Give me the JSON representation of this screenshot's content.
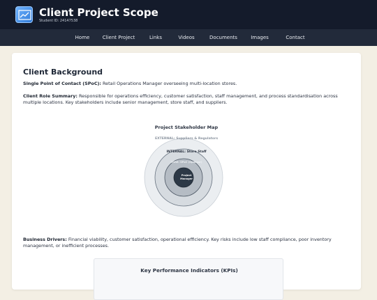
{
  "header": {
    "title": "Client Project Scope",
    "student_id": "Student ID: 24147538",
    "colors": {
      "header_bg": "#141b2b",
      "nav_bg": "#222a3a",
      "page_bg": "#f3efe4"
    }
  },
  "nav": {
    "items": [
      "Home",
      "Client Project",
      "Links",
      "Videos",
      "Documents",
      "Images",
      "Contact"
    ]
  },
  "section": {
    "heading": "Client Background",
    "spoc_label": "Single Point of Contact (SPoC):",
    "spoc_text": " Retail Operations Manager overseeing multi-location stores.",
    "role_label": "Client Role Summary:",
    "role_text": " Responsible for operations efficiency, customer satisfaction, staff management, and process standardisation across multiple locations. Key stakeholders include senior management, store staff, and suppliers.",
    "drivers_label": "Business Drivers:",
    "drivers_text": " Financial viability, customer satisfaction, operational efficiency. Key risks include low staff compliance, poor inventory management, or inefficient processes."
  },
  "stakeholder_map": {
    "title": "Project Stakeholder Map",
    "external_label": "EXTERNAL: Suppliers & Regulators",
    "internal_label": "INTERNAL: Store Staff",
    "core_label": "CORE: SPoC (Sponsor)",
    "center_label_line1": "Project",
    "center_label_line2": "Manager"
  },
  "kpi": {
    "title": "Key Performance Indicators (KPIs)"
  }
}
